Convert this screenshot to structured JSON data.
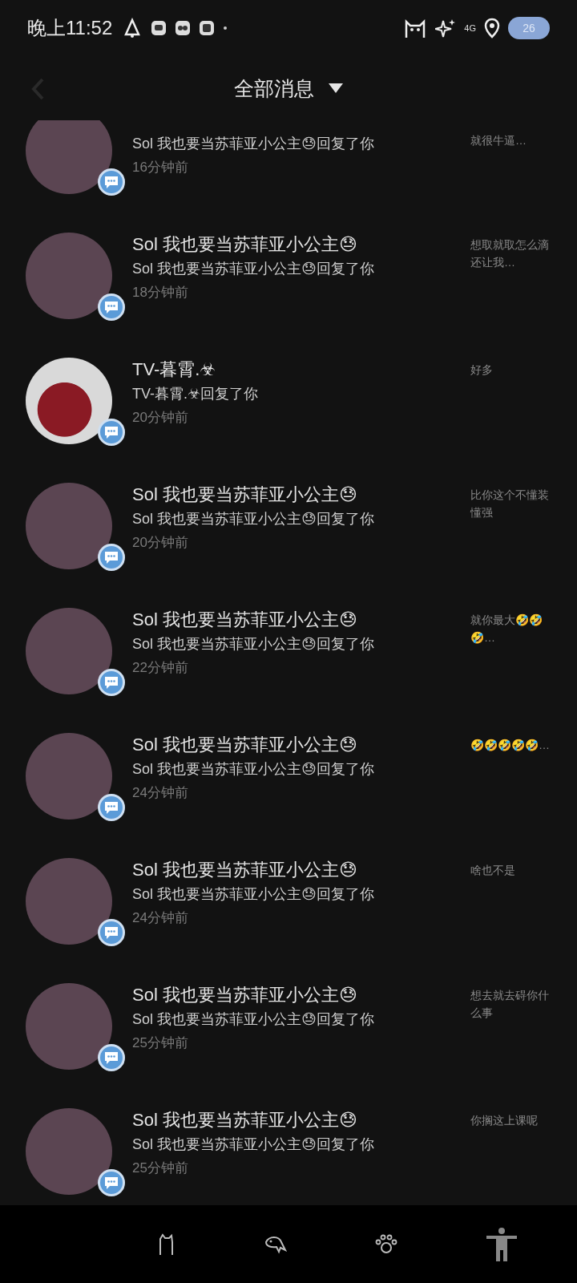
{
  "status_bar": {
    "time": "晚上11:52",
    "network": "4G",
    "battery": "26"
  },
  "header": {
    "title": "全部消息"
  },
  "messages": [
    {
      "kind": "plain",
      "subtitle": "Sol 我也要当苏菲亚小公主😓回复了你",
      "time": "16分钟前",
      "preview": "就很牛逼…"
    },
    {
      "kind": "plain",
      "name": "Sol 我也要当苏菲亚小公主😓",
      "subtitle": "Sol 我也要当苏菲亚小公主😓回复了你",
      "time": "18分钟前",
      "preview": "想取就取怎么滴还让我…"
    },
    {
      "kind": "photo",
      "name": "TV-暮霄.☣",
      "subtitle": "TV-暮霄.☣回复了你",
      "time": "20分钟前",
      "preview": "好多"
    },
    {
      "kind": "plain",
      "name": "Sol 我也要当苏菲亚小公主😓",
      "subtitle": "Sol 我也要当苏菲亚小公主😓回复了你",
      "time": "20分钟前",
      "preview": "比你这个不懂装懂强"
    },
    {
      "kind": "plain",
      "name": "Sol 我也要当苏菲亚小公主😓",
      "subtitle": "Sol 我也要当苏菲亚小公主😓回复了你",
      "time": "22分钟前",
      "preview": "就你最大🤣🤣🤣…"
    },
    {
      "kind": "plain",
      "name": "Sol 我也要当苏菲亚小公主😓",
      "subtitle": "Sol 我也要当苏菲亚小公主😓回复了你",
      "time": "24分钟前",
      "preview": "🤣🤣🤣🤣🤣…"
    },
    {
      "kind": "plain",
      "name": "Sol 我也要当苏菲亚小公主😓",
      "subtitle": "Sol 我也要当苏菲亚小公主😓回复了你",
      "time": "24分钟前",
      "preview": "啥也不是"
    },
    {
      "kind": "plain",
      "name": "Sol 我也要当苏菲亚小公主😓",
      "subtitle": "Sol 我也要当苏菲亚小公主😓回复了你",
      "time": "25分钟前",
      "preview": "想去就去碍你什么事"
    },
    {
      "kind": "plain",
      "name": "Sol 我也要当苏菲亚小公主😓",
      "subtitle": "Sol 我也要当苏菲亚小公主😓回复了你",
      "time": "25分钟前",
      "preview": "你搁这上课呢"
    }
  ]
}
